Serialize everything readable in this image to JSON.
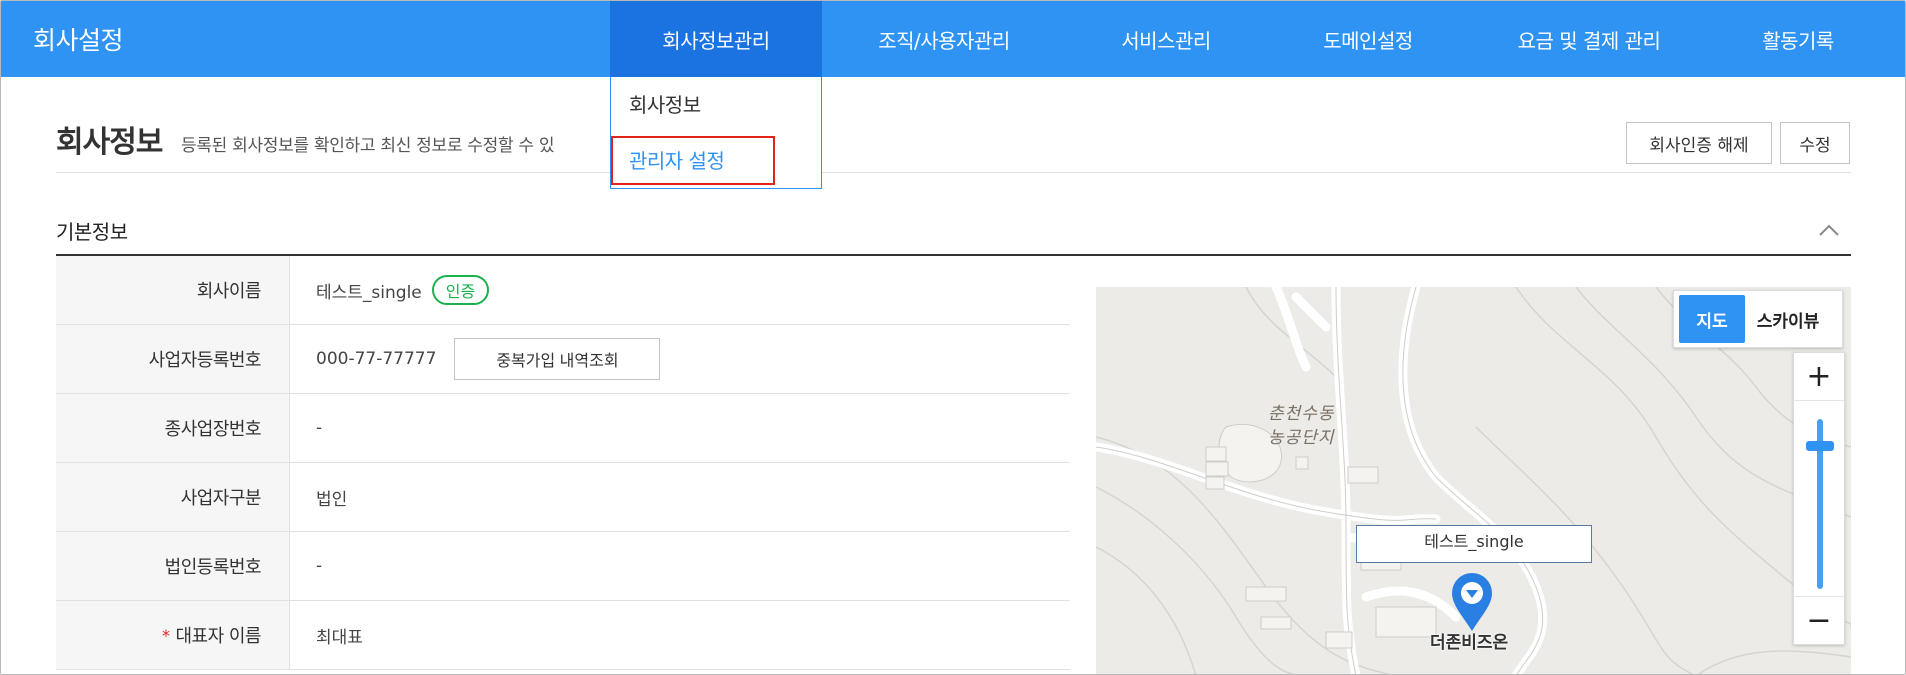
{
  "app": {
    "title": "회사설정"
  },
  "nav": {
    "items": [
      {
        "label": "회사정보관리",
        "active": true
      },
      {
        "label": "조직/사용자관리"
      },
      {
        "label": "서비스관리"
      },
      {
        "label": "도메인설정"
      },
      {
        "label": "요금 및 결제 관리"
      },
      {
        "label": "활동기록"
      }
    ],
    "dropdown": [
      {
        "label": "회사정보"
      },
      {
        "label": "관리자 설정",
        "highlighted": true
      }
    ]
  },
  "page": {
    "title": "회사정보",
    "description": "등록된 회사정보를 확인하고 최신 정보로 수정할 수 있",
    "buttons": {
      "unverify": "회사인증 해제",
      "edit": "수정"
    }
  },
  "section": {
    "title": "기본정보",
    "toggle_icon": "chevron-up-icon"
  },
  "info": {
    "company_name": {
      "label": "회사이름",
      "value": "테스트_single",
      "badge": "인증"
    },
    "business_reg_no": {
      "label": "사업자등록번호",
      "value": "000-77-77777",
      "button": "중복가입 내역조회"
    },
    "branch_no": {
      "label": "종사업장번호",
      "value": "-"
    },
    "business_type": {
      "label": "사업자구분",
      "value": "법인"
    },
    "corp_reg_no": {
      "label": "법인등록번호",
      "value": "-"
    },
    "ceo_name": {
      "label": "대표자 이름",
      "required_mark": "*",
      "value": "최대표"
    }
  },
  "map": {
    "toggle": {
      "map": "지도",
      "skyview": "스카이뷰",
      "selected": "map"
    },
    "zoom": {
      "in": "+",
      "out": "−"
    },
    "place_labels": [
      "춘천수동",
      "농공단지"
    ],
    "poi_label": "테스트_single",
    "poi_name": "더존비즈온"
  },
  "colors": {
    "nav_bg": "#2f93f4",
    "nav_active": "#1a73e1",
    "accent": "#2f93f4",
    "badge": "#1bb14f",
    "highlight": "#e2231a"
  }
}
